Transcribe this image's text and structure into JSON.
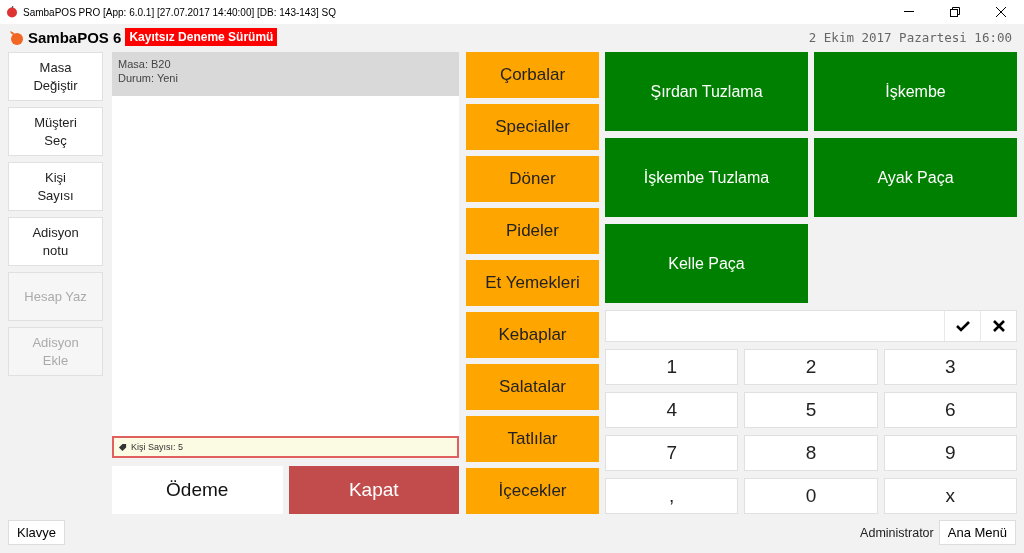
{
  "window": {
    "title": "SambaPOS PRO [App: 6.0.1] [27.07.2017 14:40:00] [DB: 143-143] SQ"
  },
  "header": {
    "logo": "SambaPOS 6",
    "badge": "Kayıtsız Deneme Sürümü",
    "datetime": "2 Ekim 2017 Pazartesi 16:00"
  },
  "actions": [
    {
      "label": "Masa\nDeğiştir",
      "disabled": false
    },
    {
      "label": "Müşteri\nSeç",
      "disabled": false
    },
    {
      "label": "Kişi\nSayısı",
      "disabled": false
    },
    {
      "label": "Adisyon\nnotu",
      "disabled": false
    },
    {
      "label": "Hesap Yaz",
      "disabled": true
    },
    {
      "label": "Adisyon\nEkle",
      "disabled": true
    }
  ],
  "ticket": {
    "lines": [
      "Masa: B20",
      "Durum: Yeni"
    ],
    "tag": "Kişi Sayısı: 5",
    "buttons": [
      {
        "label": "Ödeme",
        "kind": "plain"
      },
      {
        "label": "Kapat",
        "kind": "danger"
      }
    ]
  },
  "categories": [
    "Çorbalar",
    "Specialler",
    "Döner",
    "Pideler",
    "Et Yemekleri",
    "Kebaplar",
    "Salatalar",
    "Tatlılar",
    "İçecekler"
  ],
  "products": [
    "Şırdan Tuzlama",
    "İşkembe",
    "İşkembe Tuzlama",
    "Ayak Paça",
    "Kelle Paça"
  ],
  "keypad": [
    "1",
    "2",
    "3",
    "4",
    "5",
    "6",
    "7",
    "8",
    "9",
    ",",
    "0",
    "x"
  ],
  "footer": {
    "keyboard": "Klavye",
    "user": "Administrator",
    "menu": "Ana Menü"
  }
}
